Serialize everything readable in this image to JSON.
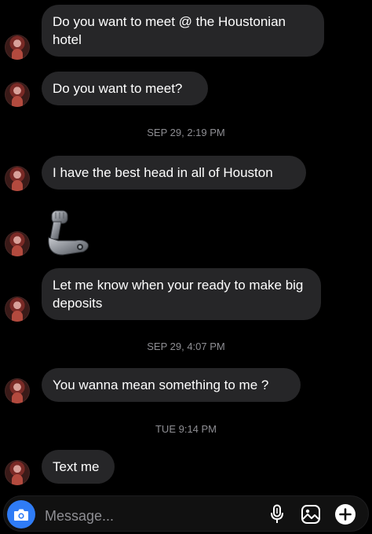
{
  "messages": [
    {
      "type": "text",
      "text": "Do you want to meet @ the Houstonian hotel"
    },
    {
      "type": "text",
      "text": "Do you want to meet?"
    },
    {
      "type": "timestamp",
      "text": "SEP 29, 2:19 PM"
    },
    {
      "type": "text",
      "text": "I have the best head in all of Houston"
    },
    {
      "type": "emoji",
      "emoji": "flexed-biceps-mechanical-arm"
    },
    {
      "type": "text",
      "text": "Let me know when your ready to make big deposits"
    },
    {
      "type": "timestamp",
      "text": "SEP 29, 4:07 PM"
    },
    {
      "type": "text",
      "text": "You wanna mean something to me ?"
    },
    {
      "type": "timestamp",
      "text": "TUE 9:14 PM"
    },
    {
      "type": "text",
      "text": "Text me"
    }
  ],
  "composer": {
    "placeholder": "Message...",
    "camera_icon": "camera-icon",
    "mic_icon": "microphone-icon",
    "gallery_icon": "gallery-icon",
    "add_icon": "add-icon"
  },
  "colors": {
    "background": "#000000",
    "bubble": "#262628",
    "timestamp": "#8e8e93",
    "accent": "#2f7cf6"
  }
}
